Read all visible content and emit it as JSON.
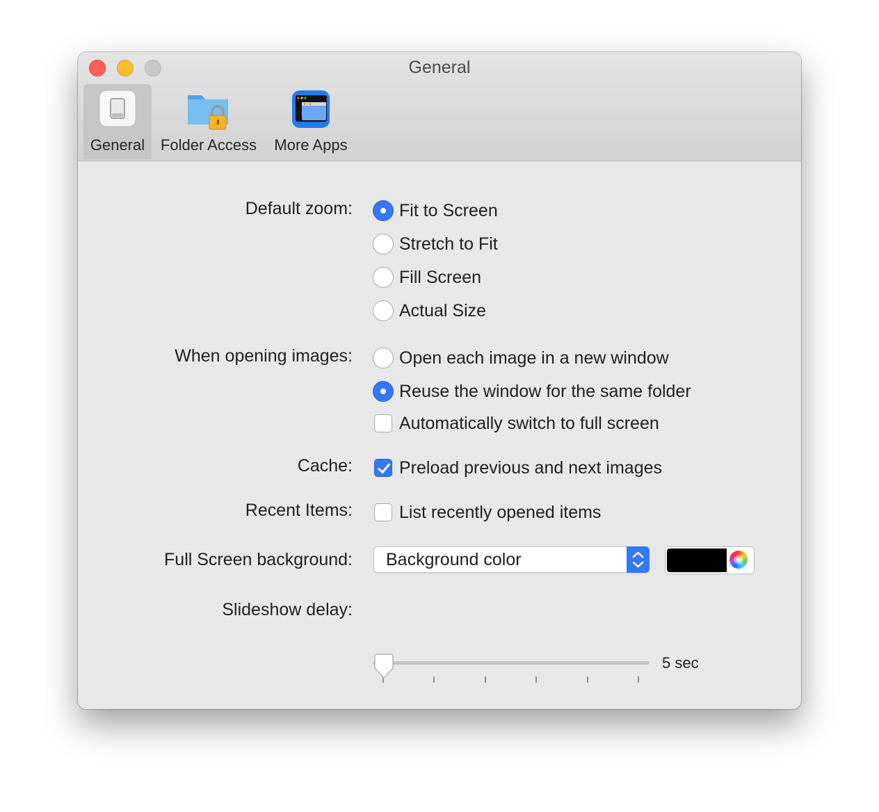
{
  "window": {
    "title": "General"
  },
  "toolbar": {
    "tabs": [
      {
        "label": "General",
        "icon": "light-switch-icon"
      },
      {
        "label": "Folder Access",
        "icon": "folder-lock-icon"
      },
      {
        "label": "More Apps",
        "icon": "app-window-icon"
      }
    ],
    "selected": "General"
  },
  "settings": {
    "default_zoom": {
      "label": "Default zoom:",
      "options": [
        "Fit to Screen",
        "Stretch to Fit",
        "Fill Screen",
        "Actual Size"
      ],
      "selected": "Fit to Screen"
    },
    "opening_images": {
      "label": "When opening images:",
      "options": [
        "Open each image in a new window",
        "Reuse the window for the same folder"
      ],
      "selected": "Reuse the window for the same folder",
      "fullscreen_checkbox": {
        "label": "Automatically switch to full screen",
        "checked": false
      }
    },
    "cache": {
      "label": "Cache:",
      "checkbox": {
        "label": "Preload previous and next images",
        "checked": true
      }
    },
    "recent_items": {
      "label": "Recent Items:",
      "checkbox": {
        "label": "List recently opened items",
        "checked": false
      }
    },
    "fullscreen_background": {
      "label": "Full Screen background:",
      "popup_value": "Background color",
      "color": "#000000"
    },
    "slideshow_delay": {
      "label": "Slideshow delay:",
      "value_text": "5 sec",
      "position_fraction": 0
    }
  },
  "colors": {
    "accent": "#3478f6",
    "close": "#fe5f57",
    "minimize": "#febc2e",
    "zoom_inactive": "#c8c8c8"
  }
}
